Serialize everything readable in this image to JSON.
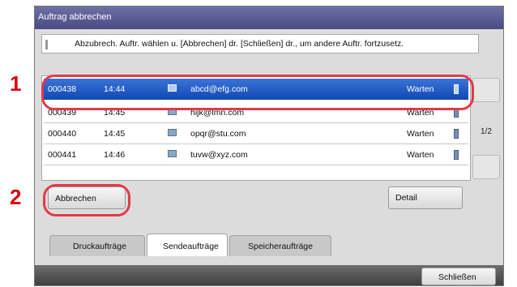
{
  "callouts": {
    "one": "1",
    "two": "2"
  },
  "window": {
    "title": "Auftrag abbrechen"
  },
  "instruction": "Abzubrech. Auftr. wählen u. [Abbrechen] dr. [Schließen] dr., um andere Auftr. fortzusetz.",
  "jobs": [
    {
      "id": "000438",
      "time": "14:44",
      "destination": "abcd@efg.com",
      "status": "Warten",
      "selected": true
    },
    {
      "id": "000439",
      "time": "14:45",
      "destination": "hijk@lmn.com",
      "status": "Warten",
      "selected": false
    },
    {
      "id": "000440",
      "time": "14:45",
      "destination": "opqr@stu.com",
      "status": "Warten",
      "selected": false
    },
    {
      "id": "000441",
      "time": "14:46",
      "destination": "tuvw@xyz.com",
      "status": "Warten",
      "selected": false
    }
  ],
  "pager": {
    "page": "1/2"
  },
  "buttons": {
    "cancel": "Abbrechen",
    "detail": "Detail",
    "close": "Schließen"
  },
  "tabs": [
    {
      "label": "Druckaufträge",
      "active": false
    },
    {
      "label": "Sendeaufträge",
      "active": true
    },
    {
      "label": "Speicheraufträge",
      "active": false
    }
  ],
  "colors": {
    "selection": "#1a56c4",
    "callout": "#d80012",
    "titlebar": "#5a5a94"
  },
  "icons": {
    "job_type": "send-icon",
    "row_marker": "status-square-icon"
  }
}
